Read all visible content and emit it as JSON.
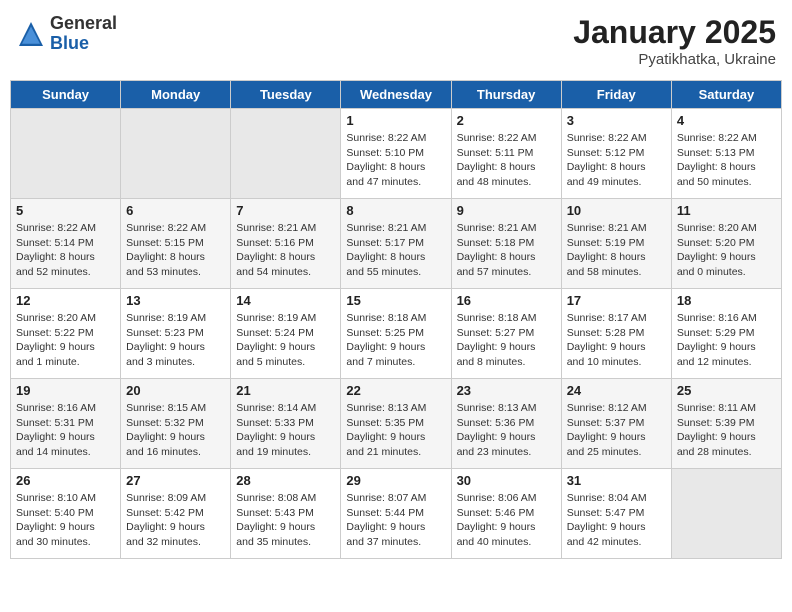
{
  "header": {
    "logo_general": "General",
    "logo_blue": "Blue",
    "month_title": "January 2025",
    "location": "Pyatikhatka, Ukraine"
  },
  "days_of_week": [
    "Sunday",
    "Monday",
    "Tuesday",
    "Wednesday",
    "Thursday",
    "Friday",
    "Saturday"
  ],
  "weeks": [
    [
      {
        "day": "",
        "info": ""
      },
      {
        "day": "",
        "info": ""
      },
      {
        "day": "",
        "info": ""
      },
      {
        "day": "1",
        "info": "Sunrise: 8:22 AM\nSunset: 5:10 PM\nDaylight: 8 hours and 47 minutes."
      },
      {
        "day": "2",
        "info": "Sunrise: 8:22 AM\nSunset: 5:11 PM\nDaylight: 8 hours and 48 minutes."
      },
      {
        "day": "3",
        "info": "Sunrise: 8:22 AM\nSunset: 5:12 PM\nDaylight: 8 hours and 49 minutes."
      },
      {
        "day": "4",
        "info": "Sunrise: 8:22 AM\nSunset: 5:13 PM\nDaylight: 8 hours and 50 minutes."
      }
    ],
    [
      {
        "day": "5",
        "info": "Sunrise: 8:22 AM\nSunset: 5:14 PM\nDaylight: 8 hours and 52 minutes."
      },
      {
        "day": "6",
        "info": "Sunrise: 8:22 AM\nSunset: 5:15 PM\nDaylight: 8 hours and 53 minutes."
      },
      {
        "day": "7",
        "info": "Sunrise: 8:21 AM\nSunset: 5:16 PM\nDaylight: 8 hours and 54 minutes."
      },
      {
        "day": "8",
        "info": "Sunrise: 8:21 AM\nSunset: 5:17 PM\nDaylight: 8 hours and 55 minutes."
      },
      {
        "day": "9",
        "info": "Sunrise: 8:21 AM\nSunset: 5:18 PM\nDaylight: 8 hours and 57 minutes."
      },
      {
        "day": "10",
        "info": "Sunrise: 8:21 AM\nSunset: 5:19 PM\nDaylight: 8 hours and 58 minutes."
      },
      {
        "day": "11",
        "info": "Sunrise: 8:20 AM\nSunset: 5:20 PM\nDaylight: 9 hours and 0 minutes."
      }
    ],
    [
      {
        "day": "12",
        "info": "Sunrise: 8:20 AM\nSunset: 5:22 PM\nDaylight: 9 hours and 1 minute."
      },
      {
        "day": "13",
        "info": "Sunrise: 8:19 AM\nSunset: 5:23 PM\nDaylight: 9 hours and 3 minutes."
      },
      {
        "day": "14",
        "info": "Sunrise: 8:19 AM\nSunset: 5:24 PM\nDaylight: 9 hours and 5 minutes."
      },
      {
        "day": "15",
        "info": "Sunrise: 8:18 AM\nSunset: 5:25 PM\nDaylight: 9 hours and 7 minutes."
      },
      {
        "day": "16",
        "info": "Sunrise: 8:18 AM\nSunset: 5:27 PM\nDaylight: 9 hours and 8 minutes."
      },
      {
        "day": "17",
        "info": "Sunrise: 8:17 AM\nSunset: 5:28 PM\nDaylight: 9 hours and 10 minutes."
      },
      {
        "day": "18",
        "info": "Sunrise: 8:16 AM\nSunset: 5:29 PM\nDaylight: 9 hours and 12 minutes."
      }
    ],
    [
      {
        "day": "19",
        "info": "Sunrise: 8:16 AM\nSunset: 5:31 PM\nDaylight: 9 hours and 14 minutes."
      },
      {
        "day": "20",
        "info": "Sunrise: 8:15 AM\nSunset: 5:32 PM\nDaylight: 9 hours and 16 minutes."
      },
      {
        "day": "21",
        "info": "Sunrise: 8:14 AM\nSunset: 5:33 PM\nDaylight: 9 hours and 19 minutes."
      },
      {
        "day": "22",
        "info": "Sunrise: 8:13 AM\nSunset: 5:35 PM\nDaylight: 9 hours and 21 minutes."
      },
      {
        "day": "23",
        "info": "Sunrise: 8:13 AM\nSunset: 5:36 PM\nDaylight: 9 hours and 23 minutes."
      },
      {
        "day": "24",
        "info": "Sunrise: 8:12 AM\nSunset: 5:37 PM\nDaylight: 9 hours and 25 minutes."
      },
      {
        "day": "25",
        "info": "Sunrise: 8:11 AM\nSunset: 5:39 PM\nDaylight: 9 hours and 28 minutes."
      }
    ],
    [
      {
        "day": "26",
        "info": "Sunrise: 8:10 AM\nSunset: 5:40 PM\nDaylight: 9 hours and 30 minutes."
      },
      {
        "day": "27",
        "info": "Sunrise: 8:09 AM\nSunset: 5:42 PM\nDaylight: 9 hours and 32 minutes."
      },
      {
        "day": "28",
        "info": "Sunrise: 8:08 AM\nSunset: 5:43 PM\nDaylight: 9 hours and 35 minutes."
      },
      {
        "day": "29",
        "info": "Sunrise: 8:07 AM\nSunset: 5:44 PM\nDaylight: 9 hours and 37 minutes."
      },
      {
        "day": "30",
        "info": "Sunrise: 8:06 AM\nSunset: 5:46 PM\nDaylight: 9 hours and 40 minutes."
      },
      {
        "day": "31",
        "info": "Sunrise: 8:04 AM\nSunset: 5:47 PM\nDaylight: 9 hours and 42 minutes."
      },
      {
        "day": "",
        "info": ""
      }
    ]
  ]
}
